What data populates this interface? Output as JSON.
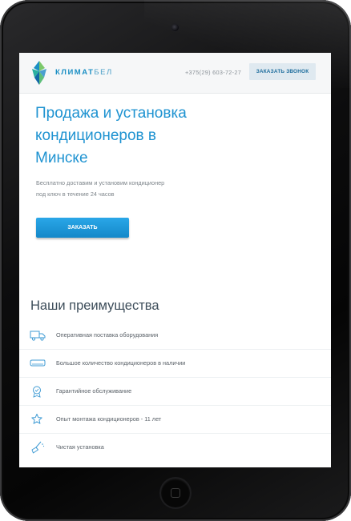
{
  "header": {
    "logo_main": "КЛИМАТ",
    "logo_suffix": "БЕЛ",
    "phone": "+375(29) 603-72-27",
    "callback_label": "ЗАКАЗАТЬ ЗВОНОК"
  },
  "hero": {
    "title_line1": "Продажа и установка",
    "title_line2": "кондиционеров в",
    "title_line3": "Минске",
    "subtitle_line1": "Бесплатно доставим и установим кондиционер",
    "subtitle_line2": "под ключ в течение 24 часов",
    "order_label": "ЗАКАЗАТЬ"
  },
  "advantages": {
    "title": "Наши преимущества",
    "items": [
      {
        "icon": "truck-icon",
        "label": "Оперативная поставка оборудования"
      },
      {
        "icon": "air-conditioner-icon",
        "label": "Большое количество кондиционеров в наличии"
      },
      {
        "icon": "badge-icon",
        "label": "Гарантийное обслуживание"
      },
      {
        "icon": "star-icon",
        "label": "Опыт монтажа кондиционеров - 11 лет"
      },
      {
        "icon": "broom-icon",
        "label": "Чистая установка"
      }
    ]
  },
  "colors": {
    "accent": "#1f93d1",
    "button": "#1a96d8",
    "heading": "#3d4d5a"
  }
}
